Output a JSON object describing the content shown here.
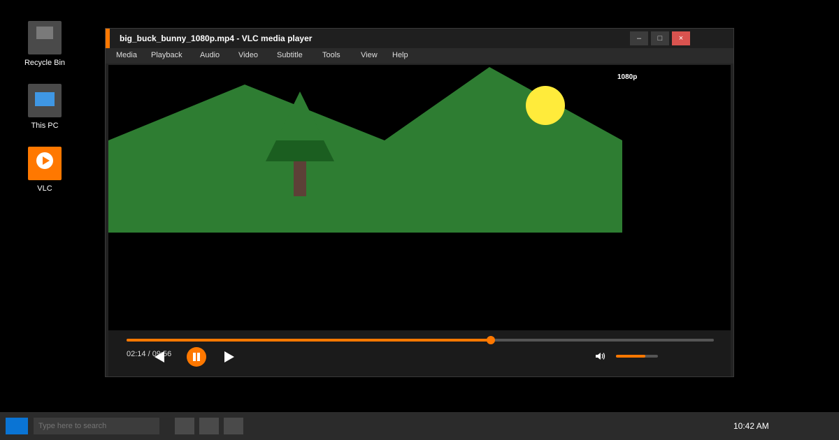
{
  "desktop": {
    "icons": [
      {
        "label": "Recycle Bin",
        "icon": "recycle-bin-icon"
      },
      {
        "label": "This PC",
        "icon": "computer-icon"
      },
      {
        "label": "VLC",
        "icon": "vlc-icon"
      }
    ]
  },
  "window": {
    "title": "big_buck_bunny_1080p.mp4 - VLC media player",
    "accent_color": "#ff7800",
    "controls": {
      "minimize": "–",
      "maximize": "□",
      "close": "×"
    }
  },
  "menu": [
    "Media",
    "Playback",
    "Audio",
    "Video",
    "Subtitle",
    "Tools",
    "View",
    "Help"
  ],
  "video": {
    "quality_badge": "1080p"
  },
  "playback": {
    "current_time": "02:14",
    "separator": " / ",
    "total_time": "09:56",
    "progress_fraction": 0.62,
    "volume_fraction": 0.7,
    "state": "playing"
  },
  "taskbar": {
    "search_placeholder": "Type here to search",
    "clock": "10:42 AM",
    "start_color": "#0a74d4"
  }
}
